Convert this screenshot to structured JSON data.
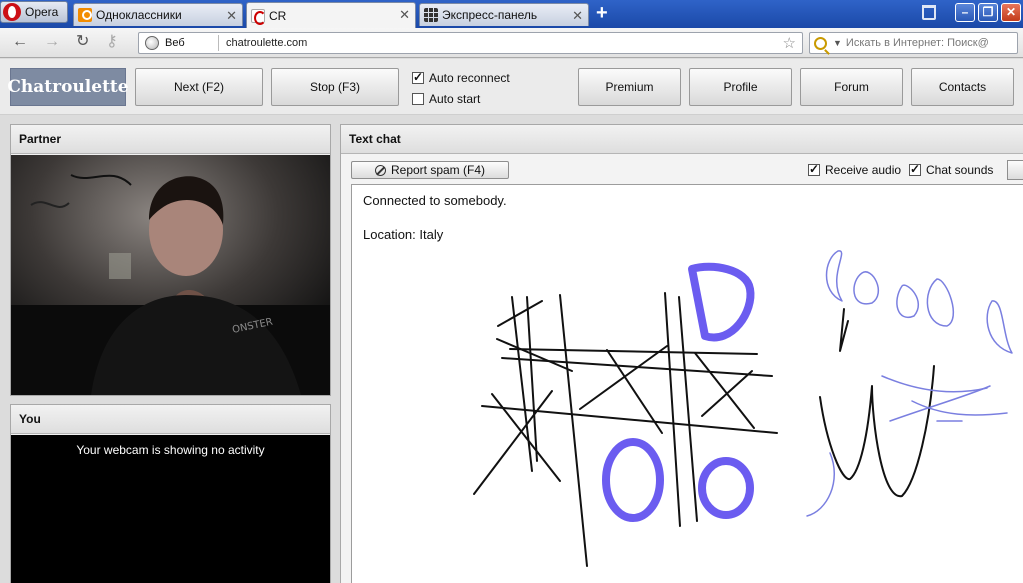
{
  "browser": {
    "menu_label": "Opera",
    "tabs": [
      {
        "label": "Одноклассники",
        "active": false
      },
      {
        "label": "CR",
        "active": true
      },
      {
        "label": "Экспресс-панель",
        "active": false
      }
    ],
    "address": {
      "scope_label": "Веб",
      "url": "chatroulette.com"
    },
    "search_placeholder": "Искать в Интернет: Поиск@"
  },
  "header": {
    "logo": "Chatroulette",
    "next_label": "Next (F2)",
    "stop_label": "Stop (F3)",
    "auto_reconnect": {
      "label": "Auto reconnect",
      "checked": true
    },
    "auto_start": {
      "label": "Auto start",
      "checked": false
    },
    "nav": [
      "Premium",
      "Profile",
      "Forum",
      "Contacts"
    ]
  },
  "partner": {
    "title": "Partner"
  },
  "you": {
    "title": "You",
    "status": "Your webcam is showing no activity"
  },
  "chat": {
    "title": "Text chat",
    "report_spam_label": "Report spam (F4)",
    "receive_audio": {
      "label": "Receive audio",
      "checked": true
    },
    "chat_sounds": {
      "label": "Chat sounds",
      "checked": true
    },
    "messages": [
      "Connected to somebody.",
      "Location: Italy"
    ]
  },
  "colors": {
    "drawing_ink": "#111111",
    "drawing_blue": "#6b5cf0",
    "drawing_thin_blue": "#7a7fe0",
    "logo_bg": "#7e8ba2"
  }
}
